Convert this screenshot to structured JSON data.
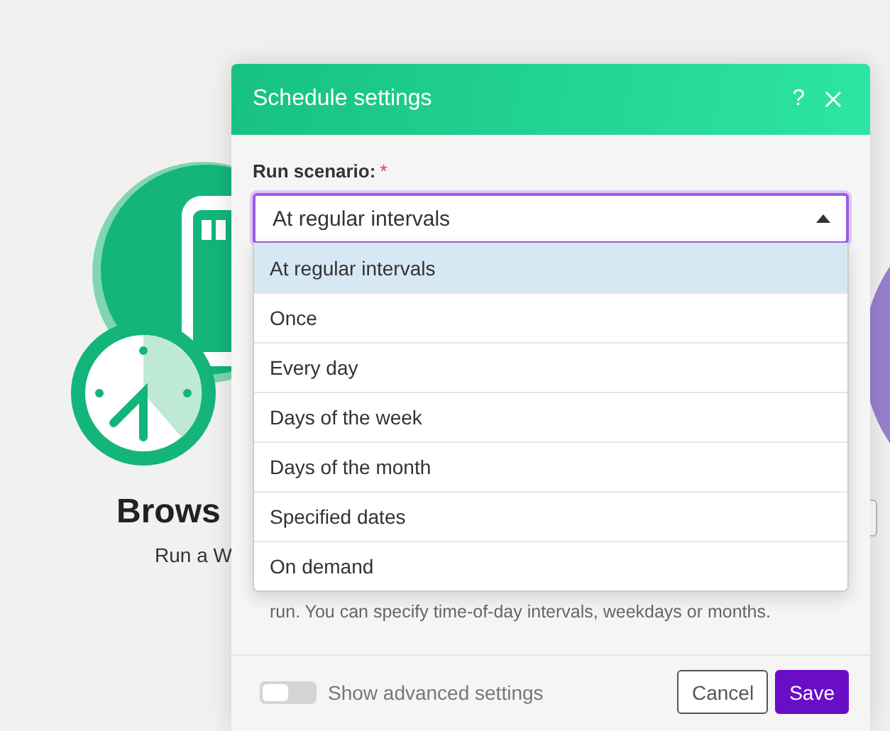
{
  "background": {
    "module": {
      "title": "Brows",
      "subtitle": "Run a W"
    }
  },
  "dialog": {
    "title": "Schedule settings",
    "help_button": "?",
    "field": {
      "label": "Run scenario:",
      "required_mark": "*",
      "value": "At regular intervals",
      "expanded": true,
      "options": [
        {
          "label": "At regular intervals",
          "selected": true
        },
        {
          "label": "Once",
          "selected": false
        },
        {
          "label": "Every day",
          "selected": false
        },
        {
          "label": "Days of the week",
          "selected": false
        },
        {
          "label": "Days of the month",
          "selected": false
        },
        {
          "label": "Specified dates",
          "selected": false
        },
        {
          "label": "On demand",
          "selected": false
        }
      ]
    },
    "help_text": "run. You can specify time-of-day intervals, weekdays or months.",
    "advanced_toggle": {
      "label": "Show advanced settings",
      "on": false
    },
    "buttons": [
      {
        "label": "Cancel",
        "kind": "secondary"
      },
      {
        "label": "Save",
        "kind": "primary"
      }
    ]
  }
}
